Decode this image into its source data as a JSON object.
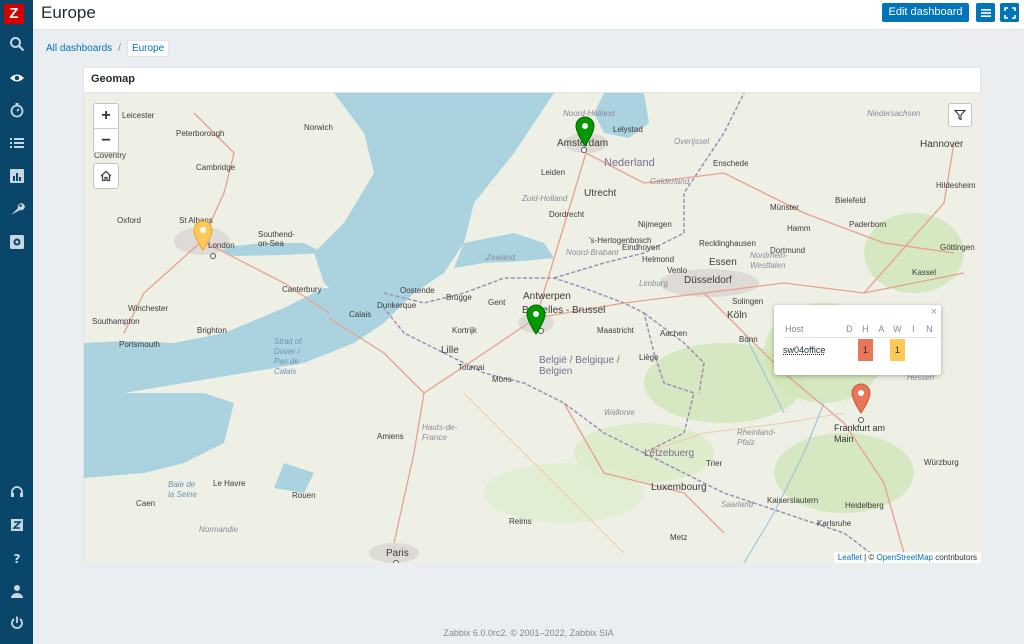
{
  "app": {
    "logo_letter": "Z"
  },
  "header": {
    "title": "Europe",
    "edit_label": "Edit dashboard"
  },
  "breadcrumb": {
    "parent": "All dashboards",
    "separator": "/",
    "current": "Europe"
  },
  "widget": {
    "title": "Geomap"
  },
  "map": {
    "labels": {
      "leicester": "Leicester",
      "norwich": "Norwich",
      "peterborough": "Peterborough",
      "coventry": "Coventry",
      "cambridge": "Cambridge",
      "oxford": "Oxford",
      "st_albans": "St Albans",
      "london": "London",
      "southend": "Southend-\non-Sea",
      "canterbury": "Canterbury",
      "winchester": "Winchester",
      "southampton": "Southampton",
      "brighton": "Brighton",
      "portsmouth": "Portsmouth",
      "calais": "Calais",
      "dunkerque": "Dunkerque",
      "oostende": "Oostende",
      "brugge": "Brugge",
      "gent": "Gent",
      "antwerpen": "Antwerpen",
      "bruxelles": "Bruxelles - Brussel",
      "kortrijk": "Kortrijk",
      "lille": "Lille",
      "tournai": "Tournai",
      "mons": "Mons",
      "amiens": "Amiens",
      "rouen": "Rouen",
      "le_havre": "Le Havre",
      "caen": "Caen",
      "paris": "Paris",
      "reims": "Reims",
      "metz": "Metz",
      "amsterdam": "Amsterdam",
      "lelystad": "Lelystad",
      "leiden": "Leiden",
      "utrecht": "Utrecht",
      "dordrecht": "Dordrecht",
      "den_bosch": "'s-Hertogenbosch",
      "nijmegen": "Nijmegen",
      "eindhoven": "Eindhoven",
      "helmond": "Helmond",
      "venlo": "Venlo",
      "maastricht": "Maastricht",
      "liege": "Liège",
      "aachen": "Aachen",
      "koln": "Köln",
      "bonn": "Bonn",
      "essen": "Essen",
      "dusseldorf": "Düsseldorf",
      "solingen": "Solingen",
      "enschede": "Enschede",
      "munster": "Münster",
      "hamm": "Hamm",
      "dortmund": "Dortmund",
      "bielefeld": "Bielefeld",
      "paderborn": "Paderborn",
      "recklinghausen": "Recklinghausen",
      "gottingen": "Göttingen",
      "kassel": "Kassel",
      "hannover": "Hannover",
      "hildesheim": "Hildesheim",
      "frankfurt": "Frankfurt am\nMain",
      "wurzburg": "Würzburg",
      "trier": "Trier",
      "luxembourg": "Luxembourg",
      "letzebuerg": "Lëtzebuerg",
      "kaiserslautern": "Kaiserslautern",
      "heidelberg": "Heidelberg",
      "karlsruhe": "Karlsruhe",
      "saarland": "Saarland",
      "nederland": "Nederland",
      "belgie": "België / Belgique /\nBelgien",
      "niedersachsen": "Niedersachsen",
      "noord_holland": "Noord-Holland",
      "zuid_holland": "Zuid-Holland",
      "zeeland": "Zeeland",
      "noord_brabant": "Noord-Brabant",
      "gelderland": "Gelderland",
      "overijssel": "Overijssel",
      "limburg": "Limburg",
      "wallonie": "Wallonie",
      "rheinland_pfalz": "Rheinland-\nPfalz",
      "nordrhein": "Nordrhein-\nWestfalen",
      "hessen": "Hessen",
      "hauts_de_france": "Hauts-de-\nFrance",
      "normandie": "Normandie",
      "strait": "Strait of\nDover /\nPas de\nCalais",
      "baie": "Baie de\nla Seine"
    }
  },
  "popup": {
    "close": "×",
    "headers": {
      "host": "Host",
      "d": "D",
      "h": "H",
      "a": "A",
      "w": "W",
      "i": "I",
      "n": "N"
    },
    "rows": [
      {
        "host": "sw04office",
        "d": "",
        "h": "1",
        "a": "",
        "w": "1",
        "i": "",
        "n": ""
      }
    ],
    "colors": {
      "high": "#e97659",
      "warning": "#ffc859"
    }
  },
  "markers": {
    "colors": {
      "ok": "#009900",
      "warning": "#ffc859",
      "high": "#e97659"
    }
  },
  "attribution": {
    "leaflet": "Leaflet",
    "sep": " | © ",
    "osm": "OpenStreetMap",
    "suffix": " contributors"
  },
  "footer": {
    "text": "Zabbix 6.0.0rc2. © 2001–2022, Zabbix SIA"
  }
}
